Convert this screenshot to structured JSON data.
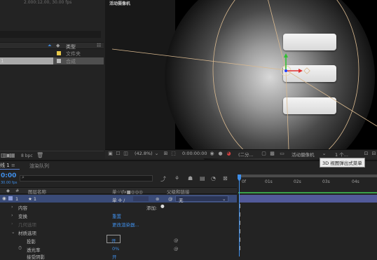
{
  "project": {
    "info": "2.000:12.00, 30.00 fps",
    "header_type": "类型",
    "rows": [
      {
        "name": "",
        "type": "文件夹",
        "color": "#e8c84a"
      },
      {
        "name": "1",
        "type": "合成",
        "color": "#b8b8b8"
      }
    ],
    "bpc": "8 bpc"
  },
  "viewer": {
    "title": "活动摄像机",
    "toolbar": {
      "zoom": "(42.8%)",
      "time": "0:00:00:00",
      "resolution": "(二分...",
      "camera": "活动摄像机",
      "views": "1 个..."
    },
    "tooltip": "3D 视图弹出式菜单"
  },
  "timeline": {
    "tab_comp": "线 1",
    "tab_render": "渲染队列",
    "timecode": "0:00",
    "fps": "30.00 fps",
    "search_placeholder": "",
    "headers": {
      "num": "#",
      "name": "图层名称",
      "switches": "单☆\\fx■◎◎◎",
      "parent": "父级和链接"
    },
    "layers": [
      {
        "num": "1",
        "name": "★ 1",
        "parent": "无"
      }
    ],
    "properties": [
      {
        "label": "内容",
        "value": "添加:",
        "indent": 1
      },
      {
        "label": "变换",
        "value": "重置",
        "indent": 1
      },
      {
        "label": "几何选项",
        "value": "更改渲染器...",
        "indent": 1
      },
      {
        "label": "材质选项",
        "value": "",
        "indent": 1
      },
      {
        "label": "投影",
        "value": "开",
        "indent": 2
      },
      {
        "label": "透光率",
        "value": "0%",
        "indent": 2
      },
      {
        "label": "接受阴影",
        "value": "开",
        "indent": 2
      }
    ],
    "ticks": [
      "0f",
      "01s",
      "02s",
      "03s",
      "04s"
    ]
  },
  "colors": {
    "accent_blue": "#3f8ee8",
    "layer_bar": "#525a9a",
    "work_green": "#3aa04a"
  }
}
